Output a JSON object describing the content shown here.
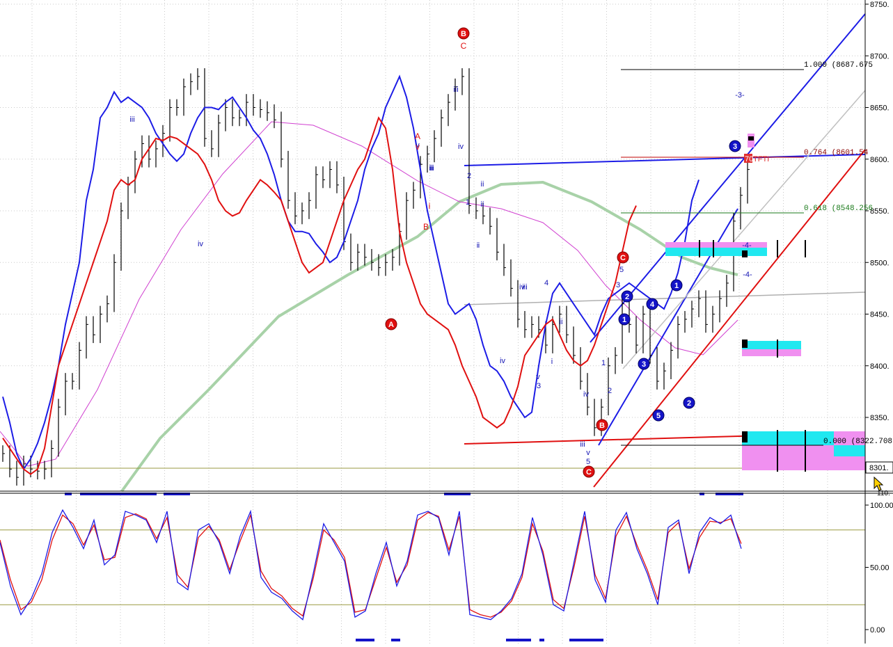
{
  "colors": {
    "background": "#ffffff",
    "grid": "#c8c8c8",
    "price_bar": "#000000",
    "upper_band": "#1c1ce6",
    "lower_band": "#e01010",
    "ma_magenta": "#d040d0",
    "ma_green": "#a8d2a8",
    "fib_green": "#1a7a1a",
    "fib_red": "#c00000",
    "cyan_box": "#20e8f0",
    "pink_box": "#f090f0",
    "osc_level": "#9a9a40"
  },
  "chart_data": [
    {
      "type": "line",
      "name": "price",
      "yticks": [
        8350,
        8400,
        8450,
        8500,
        8550,
        8600,
        8650,
        8700,
        8750
      ],
      "ytick_labels": [
        "8350.",
        "8400.",
        "8450.",
        "8500.",
        "8550.",
        "8600.",
        "8650.",
        "8700.",
        "8750."
      ],
      "ylim": [
        8287,
        8752
      ],
      "price_marker": "8301.",
      "x": [
        0,
        10,
        20,
        30,
        40,
        50,
        60,
        70,
        80,
        90,
        100,
        110,
        120,
        130,
        140,
        150,
        160,
        170,
        180,
        190,
        200,
        210,
        220,
        230,
        240,
        250,
        260,
        270,
        280,
        290,
        300,
        310,
        320,
        330,
        340,
        350,
        360,
        370,
        380,
        390,
        400,
        410,
        420,
        430,
        440,
        450,
        460,
        470,
        480,
        490,
        500,
        510,
        520,
        530,
        540,
        550,
        560,
        570,
        580,
        590,
        600,
        610,
        620,
        630,
        640,
        650,
        660,
        670,
        680,
        690,
        700,
        710,
        720,
        730,
        740,
        750,
        760,
        770,
        780,
        790,
        800,
        810,
        820,
        830,
        840,
        850,
        860,
        870,
        880,
        890,
        900,
        910,
        920,
        930,
        940,
        950,
        960,
        970,
        980,
        990,
        1000,
        1010,
        1020,
        1030,
        1040,
        1050,
        1060,
        1070
      ],
      "close": [
        8315,
        8300,
        8292,
        8305,
        8300,
        8298,
        8300,
        8320,
        8360,
        8385,
        8385,
        8415,
        8440,
        8430,
        8450,
        8460,
        8500,
        8550,
        8575,
        8600,
        8615,
        8600,
        8610,
        8625,
        8650,
        8650,
        8670,
        8675,
        8680,
        8620,
        8610,
        8635,
        8650,
        8640,
        8640,
        8655,
        8650,
        8648,
        8645,
        8638,
        8600,
        8560,
        8545,
        8550,
        8560,
        8585,
        8580,
        8590,
        8575,
        8520,
        8500,
        8510,
        8505,
        8500,
        8495,
        8500,
        8505,
        8530,
        8560,
        8570,
        8595,
        8605,
        8620,
        8640,
        8655,
        8670,
        8680,
        8555,
        8550,
        8545,
        8535,
        8510,
        8495,
        8475,
        8445,
        8435,
        8440,
        8435,
        8420,
        8440,
        8450,
        8430,
        8410,
        8385,
        8360,
        8340,
        8360,
        8400,
        8410,
        8460,
        8440,
        8420,
        8450,
        8410,
        8385,
        8395,
        8415,
        8440,
        8445,
        8455,
        8465,
        8440,
        8450,
        8465,
        8480,
        8540,
        8565,
        8590
      ],
      "upper_band": [
        8370,
        8345,
        8315,
        8300,
        8310,
        8325,
        8345,
        8370,
        8400,
        8440,
        8470,
        8500,
        8560,
        8590,
        8640,
        8650,
        8665,
        8655,
        8660,
        8655,
        8650,
        8640,
        8625,
        8615,
        8605,
        8598,
        8605,
        8625,
        8640,
        8650,
        8650,
        8648,
        8655,
        8660,
        8650,
        8640,
        8628,
        8620,
        8605,
        8585,
        8560,
        8540,
        8530,
        8530,
        8528,
        8518,
        8510,
        8500,
        8505,
        8520,
        8540,
        8560,
        8590,
        8610,
        8625,
        8650,
        8665,
        8680,
        8660,
        8630,
        8590,
        8550,
        8520,
        8490,
        8460,
        8450,
        8455,
        8460,
        8445,
        8420,
        8400,
        8395,
        8385,
        8370,
        8360,
        8350,
        8355,
        8400,
        8440,
        8470,
        8480,
        8470,
        8460,
        8450,
        8440,
        8430,
        8450,
        8465,
        8470,
        8475,
        8480,
        8475,
        8470,
        8465,
        8460,
        8455,
        8470,
        8490,
        8520,
        8560,
        8580
      ],
      "lower_band": [
        8330,
        8320,
        8310,
        8300,
        8295,
        8300,
        8320,
        8360,
        8400,
        8420,
        8440,
        8460,
        8480,
        8500,
        8520,
        8540,
        8570,
        8580,
        8575,
        8580,
        8600,
        8610,
        8620,
        8618,
        8622,
        8620,
        8615,
        8610,
        8605,
        8595,
        8580,
        8560,
        8550,
        8545,
        8548,
        8560,
        8570,
        8580,
        8575,
        8568,
        8560,
        8540,
        8520,
        8500,
        8490,
        8495,
        8500,
        8520,
        8540,
        8560,
        8575,
        8590,
        8600,
        8620,
        8640,
        8630,
        8590,
        8530,
        8500,
        8480,
        8460,
        8450,
        8445,
        8440,
        8435,
        8420,
        8400,
        8385,
        8370,
        8350,
        8345,
        8340,
        8345,
        8360,
        8380,
        8410,
        8420,
        8430,
        8440,
        8445,
        8430,
        8415,
        8405,
        8400,
        8405,
        8420,
        8440,
        8460,
        8480,
        8510,
        8540,
        8555
      ]
    },
    {
      "type": "line",
      "name": "stochastic",
      "yticks": [
        0,
        50,
        100
      ],
      "ytick_labels": [
        "0.00",
        "50.00",
        "100.00"
      ],
      "levels": [
        20,
        80
      ],
      "ylim": [
        0,
        110
      ],
      "top_label": "110.",
      "x": [
        0,
        15,
        30,
        45,
        60,
        75,
        90,
        105,
        120,
        135,
        150,
        165,
        180,
        195,
        210,
        225,
        240,
        255,
        270,
        285,
        300,
        315,
        330,
        345,
        360,
        375,
        390,
        405,
        420,
        435,
        450,
        465,
        480,
        495,
        510,
        525,
        540,
        555,
        570,
        585,
        600,
        615,
        630,
        645,
        660,
        675,
        690,
        705,
        720,
        735,
        750,
        765,
        780,
        795,
        810,
        825,
        840,
        855,
        870,
        885,
        900,
        915,
        930,
        945,
        960,
        975,
        990,
        1005,
        1020,
        1035,
        1050,
        1065
      ],
      "k": [
        70,
        35,
        12,
        25,
        45,
        78,
        96,
        82,
        65,
        88,
        52,
        60,
        95,
        92,
        88,
        70,
        95,
        38,
        32,
        80,
        85,
        70,
        45,
        75,
        95,
        42,
        30,
        25,
        15,
        8,
        45,
        85,
        70,
        55,
        10,
        15,
        45,
        70,
        35,
        55,
        92,
        95,
        90,
        60,
        95,
        12,
        10,
        8,
        15,
        25,
        45,
        90,
        60,
        20,
        15,
        55,
        95,
        40,
        22,
        80,
        94,
        65,
        45,
        20,
        82,
        88,
        45,
        78,
        90,
        85,
        92,
        65
      ],
      "d": [
        72,
        40,
        16,
        22,
        40,
        72,
        92,
        85,
        68,
        84,
        56,
        58,
        90,
        93,
        89,
        73,
        90,
        44,
        34,
        74,
        83,
        72,
        48,
        71,
        92,
        47,
        33,
        27,
        17,
        11,
        41,
        80,
        72,
        58,
        14,
        16,
        41,
        66,
        38,
        52,
        88,
        94,
        91,
        64,
        91,
        16,
        12,
        10,
        14,
        23,
        42,
        85,
        63,
        24,
        17,
        51,
        91,
        44,
        25,
        75,
        91,
        68,
        48,
        24,
        78,
        86,
        49,
        74,
        87,
        86,
        89,
        69
      ]
    }
  ],
  "annotations": {
    "fib_100": "1.000 (8687.675",
    "fib_764": "0.764 (8601.54",
    "fib_618": "0.618 (8548.256",
    "fib_000": "0.000 (8322.708",
    "tfr_label": "TFTI",
    "tfr_box": "70",
    "wave_labels_blue": [
      "iii",
      "iv",
      "iii",
      "ii",
      "iv",
      "v",
      "iii",
      "iv",
      "ii",
      "ii",
      "iv",
      "i",
      "2",
      "1",
      "i",
      "ii",
      "i",
      "iii",
      "v",
      "3",
      "iv",
      "4",
      "iii",
      "v",
      "5",
      "1",
      "2",
      "3",
      "5",
      "-3-",
      "-4-",
      "-4-"
    ],
    "wave_labels_red": [
      "A",
      "B",
      "v",
      "i",
      "C",
      "C"
    ],
    "circle_red": [
      "B",
      "A",
      "B",
      "C",
      "C"
    ],
    "circle_blue": [
      "3",
      "2",
      "1",
      "4",
      "3",
      "1",
      "5",
      "2"
    ]
  }
}
